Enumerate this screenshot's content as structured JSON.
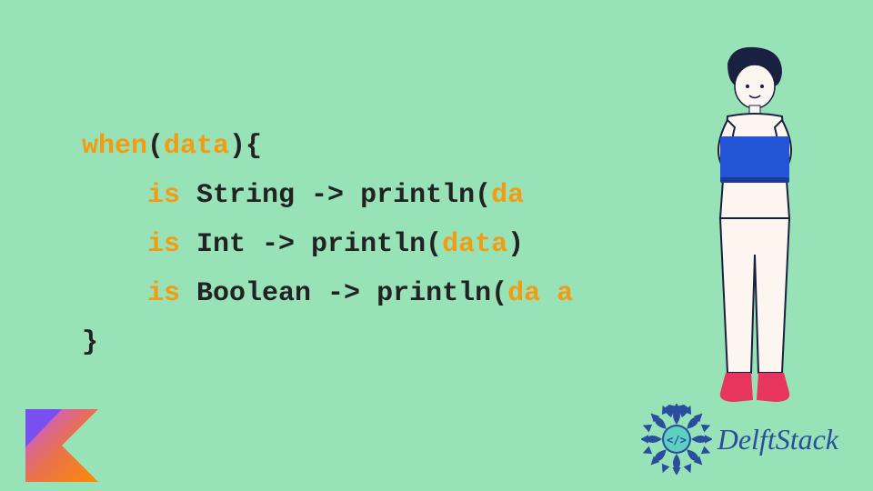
{
  "code": {
    "line1": {
      "kw1": "when",
      "p1": "(",
      "arg": "data",
      "p2": "){"
    },
    "line2": {
      "indent": "    ",
      "is": "is",
      "type": " String -> println(",
      "arg": "da",
      "end": ""
    },
    "line3": {
      "indent": "    ",
      "is": "is",
      "type": " Int -> println(",
      "arg": "data",
      "end": ")"
    },
    "line4": {
      "indent": "    ",
      "is": "is",
      "type": " Boolean -> println(",
      "arg": "da a",
      "end": ""
    },
    "line5": {
      "close": "}"
    }
  },
  "brand": {
    "name": "DelftStack"
  },
  "icons": {
    "kotlin": "kotlin-logo",
    "delft": "delft-mandala-icon",
    "person": "person-with-laptop-illustration"
  }
}
